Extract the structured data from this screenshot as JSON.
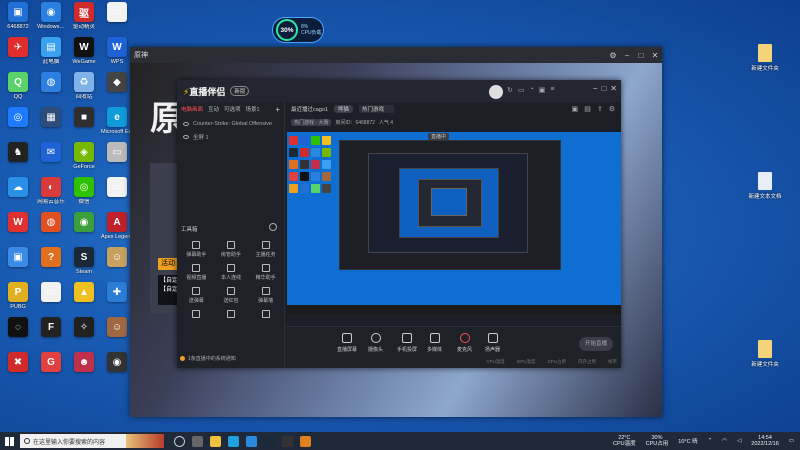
{
  "desktop_left": [
    {
      "label": "6468872",
      "color": "#1f6fd6",
      "g": "▣"
    },
    {
      "label": "Windows…",
      "color": "#2a7fe0",
      "g": "◉"
    },
    {
      "label": "驱动精灵",
      "color": "#d02a2a",
      "g": "驱"
    },
    {
      "label": "",
      "color": "#f2f2f2",
      "g": "▭"
    },
    {
      "label": "",
      "color": "#e02d2d",
      "g": "✈"
    },
    {
      "label": "此电脑",
      "color": "#3aa0f0",
      "g": "▤"
    },
    {
      "label": "WeGame",
      "color": "#111111",
      "g": "W"
    },
    {
      "label": "WPS",
      "color": "#1e63d6",
      "g": "W"
    },
    {
      "label": "QQ",
      "color": "#5ad36a",
      "g": "Q"
    },
    {
      "label": "",
      "color": "#2a7fe0",
      "g": "◍"
    },
    {
      "label": "回收站",
      "color": "#7fb2e8",
      "g": "♻"
    },
    {
      "label": "",
      "color": "#444444",
      "g": "◆"
    },
    {
      "label": "",
      "color": "#1e7bff",
      "g": "◎"
    },
    {
      "label": "",
      "color": "#2e4b7a",
      "g": "▦"
    },
    {
      "label": "",
      "color": "#2e2e2e",
      "g": "■"
    },
    {
      "label": "Microsoft Edge",
      "color": "#0f9ad8",
      "g": "e"
    },
    {
      "label": "",
      "color": "#222222",
      "g": "♞"
    },
    {
      "label": "",
      "color": "#1e63d6",
      "g": "✉"
    },
    {
      "label": "GeForce",
      "color": "#76b900",
      "g": "◈"
    },
    {
      "label": "",
      "color": "#bbbbbb",
      "g": "▭"
    },
    {
      "label": "",
      "color": "#2a8fe8",
      "g": "☁"
    },
    {
      "label": "网易云音乐",
      "color": "#d93a3a",
      "g": "◐"
    },
    {
      "label": "微信",
      "color": "#2dc100",
      "g": "◎"
    },
    {
      "label": "",
      "color": "#f2f2f2",
      "g": "▭"
    },
    {
      "label": "",
      "color": "#e03030",
      "g": "W"
    },
    {
      "label": "",
      "color": "#e05020",
      "g": "◍"
    },
    {
      "label": "",
      "color": "#3a9e3a",
      "g": "◉"
    },
    {
      "label": "Apex Legends",
      "color": "#c0202a",
      "g": "A"
    },
    {
      "label": "",
      "color": "#3a8ae8",
      "g": "▣"
    },
    {
      "label": "",
      "color": "#e07020",
      "g": "?"
    },
    {
      "label": "Steam",
      "color": "#1b2838",
      "g": "S"
    },
    {
      "label": "",
      "color": "#c8a060",
      "g": "☺"
    },
    {
      "label": "PUBG",
      "color": "#e0b020",
      "g": "P"
    },
    {
      "label": "",
      "color": "#f2f2f2",
      "g": "▭"
    },
    {
      "label": "",
      "color": "#f0c020",
      "g": "▲"
    },
    {
      "label": "",
      "color": "#2b7ed8",
      "g": "✚"
    },
    {
      "label": "",
      "color": "#111111",
      "g": "◌"
    },
    {
      "label": "",
      "color": "#222222",
      "g": "F"
    },
    {
      "label": "",
      "color": "#202020",
      "g": "✧"
    },
    {
      "label": "",
      "color": "#a06840",
      "g": "☺"
    },
    {
      "label": "",
      "color": "#d02a2a",
      "g": "✖"
    },
    {
      "label": "",
      "color": "#e04040",
      "g": "G"
    },
    {
      "label": "",
      "color": "#c0304a",
      "g": "☻"
    },
    {
      "label": "",
      "color": "#333333",
      "g": "◉"
    }
  ],
  "desktop_right": [
    {
      "label": "新建文件夹",
      "type": "folder"
    },
    {
      "label": "新建文本文档",
      "type": "doc"
    },
    {
      "label": "新建文件夹",
      "type": "folder"
    }
  ],
  "cpu": {
    "pct": "30%",
    "usage": "8%",
    "label": "CPU负载"
  },
  "main_window": {
    "title": "原神",
    "logo": "原",
    "activity": "活动",
    "act_lines": [
      "【自定】",
      "【自定】"
    ]
  },
  "live": {
    "logo": "直播伴侣",
    "version": "新版",
    "tabs": [
      "电脑画面",
      "互动",
      "可选项",
      "场景1"
    ],
    "sources": [
      "Counter-Strike: Global Offensive",
      "全屏 1"
    ],
    "tools_title": "工具箱",
    "tools": [
      "弹幕助手",
      "房管助手",
      "主播任务",
      "视频直播",
      "本人连线",
      "精华助手",
      "送弹幕",
      "送红包",
      "弹幕墙",
      "",
      "",
      ""
    ],
    "note": "1条直播中的系统通知",
    "topbar": {
      "title": "最近播过cago1",
      "btn": "熊猫",
      "field": "热门游戏"
    },
    "subbar": [
      "热门游戏 · 大赛",
      "房间ID：6468872",
      "人气 4"
    ],
    "controls": [
      "直播屏幕",
      "摄像头",
      "手机投屏",
      "多媒体",
      "麦克风",
      "扬声器"
    ],
    "start_btn": "开始直播",
    "status": [
      "CPU温度",
      "GPU温度",
      "CPU占用",
      "内存占用",
      "帧率"
    ],
    "preview_tag": "直播中"
  },
  "taskbar": {
    "search": "在这里输入你要搜索的内容",
    "temp": "22°C",
    "temp_label": "CPU温度",
    "cpu": "30%",
    "cpu_label": "CPU占用",
    "weather": "10°C 晴",
    "time": "14:54",
    "date": "2022/12/16"
  }
}
